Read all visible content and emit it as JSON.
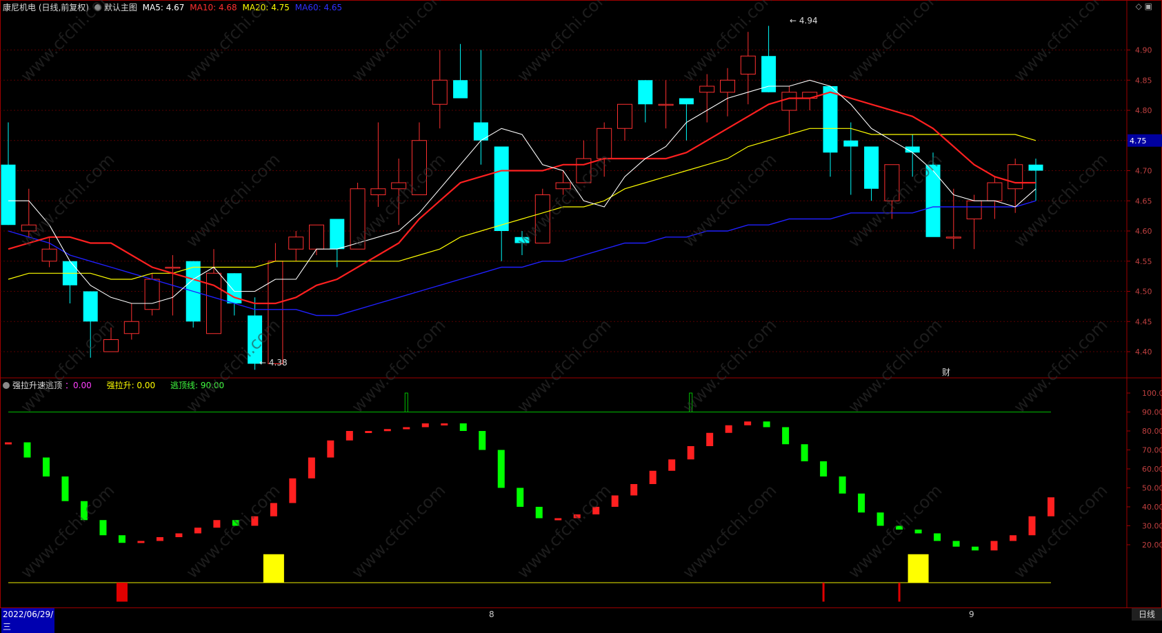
{
  "header": {
    "stock": "康尼机电 (日线,前复权)",
    "main_chart": "默认主图",
    "ma5": "MA5: 4.67",
    "ma10": "MA10: 4.68",
    "ma20": "MA20: 4.75",
    "ma60": "MA60: 4.65",
    "colors": {
      "ma5": "#ffffff",
      "ma10": "#ff2020",
      "ma20": "#ffff00",
      "ma60": "#2020ff"
    }
  },
  "indicator_header": {
    "name": "强拉升速逃顶",
    "value_label": "：0.00",
    "pull_label": "强拉升: 0.00",
    "escape_label": "逃顶线: 90.00"
  },
  "footer": {
    "date": "2022/06/29/三",
    "month_aug": "8",
    "month_sep": "9",
    "period": "日线"
  },
  "chart_data": [
    {
      "type": "candlestick",
      "title": "康尼机电 (日线,前复权)",
      "y_ticks": [
        4.4,
        4.45,
        4.5,
        4.55,
        4.6,
        4.65,
        4.7,
        4.75,
        4.8,
        4.85,
        4.9
      ],
      "ylim": [
        4.36,
        4.96
      ],
      "current_price": "4.75",
      "annotations": {
        "high": "4.94",
        "low": "4.38",
        "event": "财"
      },
      "ohlc": [
        [
          4.71,
          4.78,
          4.61,
          4.61
        ],
        [
          4.6,
          4.67,
          4.59,
          4.61
        ],
        [
          4.55,
          4.59,
          4.54,
          4.57
        ],
        [
          4.55,
          4.55,
          4.48,
          4.51
        ],
        [
          4.5,
          4.5,
          4.39,
          4.45
        ],
        [
          4.4,
          4.44,
          4.4,
          4.42
        ],
        [
          4.43,
          4.48,
          4.42,
          4.45
        ],
        [
          4.47,
          4.53,
          4.46,
          4.52
        ],
        [
          4.54,
          4.56,
          4.46,
          4.54
        ],
        [
          4.55,
          4.55,
          4.44,
          4.45
        ],
        [
          4.43,
          4.57,
          4.43,
          4.53
        ],
        [
          4.53,
          4.53,
          4.46,
          4.48
        ],
        [
          4.46,
          4.49,
          4.37,
          4.38
        ],
        [
          4.38,
          4.58,
          4.38,
          4.55
        ],
        [
          4.57,
          4.6,
          4.55,
          4.59
        ],
        [
          4.57,
          4.61,
          4.56,
          4.61
        ],
        [
          4.62,
          4.62,
          4.54,
          4.57
        ],
        [
          4.57,
          4.68,
          4.57,
          4.67
        ],
        [
          4.66,
          4.78,
          4.64,
          4.67
        ],
        [
          4.67,
          4.72,
          4.61,
          4.68
        ],
        [
          4.66,
          4.78,
          4.66,
          4.75
        ],
        [
          4.81,
          4.9,
          4.77,
          4.85
        ],
        [
          4.85,
          4.91,
          4.82,
          4.82
        ],
        [
          4.78,
          4.9,
          4.71,
          4.75
        ],
        [
          4.74,
          4.74,
          4.55,
          4.6
        ],
        [
          4.59,
          4.6,
          4.56,
          4.58
        ],
        [
          4.58,
          4.67,
          4.58,
          4.66
        ],
        [
          4.67,
          4.7,
          4.66,
          4.68
        ],
        [
          4.68,
          4.75,
          4.68,
          4.72
        ],
        [
          4.72,
          4.78,
          4.69,
          4.77
        ],
        [
          4.77,
          4.81,
          4.75,
          4.81
        ],
        [
          4.85,
          4.85,
          4.78,
          4.81
        ],
        [
          4.81,
          4.85,
          4.77,
          4.81
        ],
        [
          4.82,
          4.82,
          4.75,
          4.81
        ],
        [
          4.83,
          4.86,
          4.78,
          4.84
        ],
        [
          4.83,
          4.87,
          4.79,
          4.85
        ],
        [
          4.86,
          4.93,
          4.81,
          4.89
        ],
        [
          4.89,
          4.94,
          4.83,
          4.83
        ],
        [
          4.8,
          4.84,
          4.76,
          4.83
        ],
        [
          4.82,
          4.83,
          4.8,
          4.83
        ],
        [
          4.84,
          4.84,
          4.69,
          4.73
        ],
        [
          4.75,
          4.78,
          4.66,
          4.74
        ],
        [
          4.74,
          4.74,
          4.65,
          4.67
        ],
        [
          4.65,
          4.71,
          4.62,
          4.71
        ],
        [
          4.74,
          4.76,
          4.69,
          4.73
        ],
        [
          4.71,
          4.73,
          4.6,
          4.59
        ],
        [
          4.59,
          4.67,
          4.57,
          4.59
        ],
        [
          4.62,
          4.66,
          4.57,
          4.65
        ],
        [
          4.65,
          4.69,
          4.62,
          4.68
        ],
        [
          4.67,
          4.72,
          4.63,
          4.71
        ],
        [
          4.71,
          4.72,
          4.65,
          4.7
        ]
      ],
      "ma5": [
        4.65,
        4.65,
        4.61,
        4.55,
        4.51,
        4.49,
        4.48,
        4.48,
        4.49,
        4.52,
        4.54,
        4.5,
        4.5,
        4.52,
        4.52,
        4.57,
        4.57,
        4.58,
        4.59,
        4.6,
        4.63,
        4.67,
        4.71,
        4.75,
        4.77,
        4.76,
        4.71,
        4.7,
        4.65,
        4.64,
        4.69,
        4.72,
        4.74,
        4.78,
        4.8,
        4.82,
        4.83,
        4.84,
        4.84,
        4.85,
        4.84,
        4.81,
        4.77,
        4.75,
        4.73,
        4.7,
        4.66,
        4.65,
        4.65,
        4.64,
        4.67
      ],
      "ma10": [
        4.57,
        4.58,
        4.59,
        4.59,
        4.58,
        4.58,
        4.56,
        4.54,
        4.53,
        4.52,
        4.51,
        4.49,
        4.48,
        4.48,
        4.49,
        4.51,
        4.52,
        4.54,
        4.56,
        4.58,
        4.62,
        4.65,
        4.68,
        4.69,
        4.7,
        4.7,
        4.7,
        4.71,
        4.71,
        4.72,
        4.72,
        4.72,
        4.72,
        4.73,
        4.75,
        4.77,
        4.79,
        4.81,
        4.82,
        4.82,
        4.83,
        4.82,
        4.81,
        4.8,
        4.79,
        4.77,
        4.74,
        4.71,
        4.69,
        4.68,
        4.68
      ],
      "ma20": [
        4.52,
        4.53,
        4.53,
        4.53,
        4.53,
        4.52,
        4.52,
        4.53,
        4.53,
        4.54,
        4.54,
        4.54,
        4.54,
        4.55,
        4.55,
        4.55,
        4.55,
        4.55,
        4.55,
        4.55,
        4.56,
        4.57,
        4.59,
        4.6,
        4.61,
        4.62,
        4.63,
        4.64,
        4.64,
        4.65,
        4.67,
        4.68,
        4.69,
        4.7,
        4.71,
        4.72,
        4.74,
        4.75,
        4.76,
        4.77,
        4.77,
        4.77,
        4.76,
        4.76,
        4.76,
        4.76,
        4.76,
        4.76,
        4.76,
        4.76,
        4.75
      ],
      "ma60": [
        4.6,
        4.59,
        4.58,
        4.56,
        4.55,
        4.54,
        4.53,
        4.52,
        4.51,
        4.5,
        4.49,
        4.48,
        4.47,
        4.47,
        4.47,
        4.46,
        4.46,
        4.47,
        4.48,
        4.49,
        4.5,
        4.51,
        4.52,
        4.53,
        4.54,
        4.54,
        4.55,
        4.55,
        4.56,
        4.57,
        4.58,
        4.58,
        4.59,
        4.59,
        4.6,
        4.6,
        4.61,
        4.61,
        4.62,
        4.62,
        4.62,
        4.63,
        4.63,
        4.63,
        4.63,
        4.64,
        4.64,
        4.64,
        4.64,
        4.64,
        4.65
      ]
    },
    {
      "type": "bar",
      "title": "强拉升速逃顶",
      "y_ticks": [
        20,
        30,
        40,
        50,
        60,
        70,
        80,
        90,
        100
      ],
      "ylim": [
        0,
        105
      ],
      "escape_line": 90,
      "values": [
        74,
        66,
        56,
        43,
        33,
        25,
        21,
        22,
        24,
        26,
        29,
        33,
        30,
        35,
        42,
        55,
        66,
        75,
        80,
        80,
        81,
        82,
        84,
        84,
        80,
        70,
        50,
        40,
        34,
        34,
        36,
        40,
        46,
        52,
        59,
        65,
        72,
        79,
        83,
        85,
        82,
        73,
        64,
        56,
        47,
        37,
        30,
        28,
        26,
        22,
        19,
        17,
        22,
        25,
        35,
        45
      ],
      "spikes": [
        {
          "index": 21,
          "value": 100
        },
        {
          "index": 36,
          "value": 100
        }
      ],
      "yellow_bars": [
        {
          "index": 14,
          "value": 15
        },
        {
          "index": 48,
          "value": 15
        }
      ],
      "red_markers": [
        {
          "index": 6,
          "value": -10
        },
        {
          "index": 43,
          "value": -10
        },
        {
          "index": 47,
          "value": -10
        }
      ]
    }
  ]
}
